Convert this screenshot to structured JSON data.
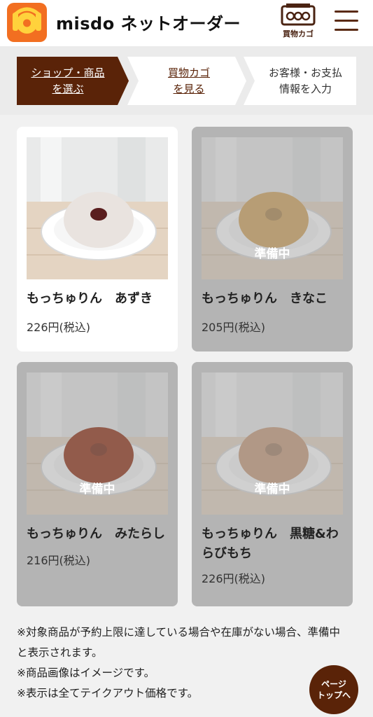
{
  "header": {
    "brand": "misdo ネットオーダー",
    "cart_label": "買物カゴ",
    "brand_color": "#f26f21",
    "accent_color": "#5a2308"
  },
  "steps": [
    {
      "line1": "ショップ・商品",
      "line2": "を選ぶ",
      "active": true
    },
    {
      "line1": "買物カゴ",
      "line2": "を見る",
      "active": false
    },
    {
      "line1": "お客様・お支払",
      "line2": "情報を入力",
      "active": false
    }
  ],
  "products": [
    {
      "name": "もっちゅりん　あずき",
      "price": "226円(税込)",
      "status": "",
      "donut_color": "#e9e3df",
      "icon": "azuki-donut-photo"
    },
    {
      "name": "もっちゅりん　きなこ",
      "price": "205円(税込)",
      "status": "準備中",
      "donut_color": "#d2a25a",
      "icon": "kinako-donut-photo"
    },
    {
      "name": "もっちゅりん　みたらし",
      "price": "216円(税込)",
      "status": "準備中",
      "donut_color": "#8e2a0e",
      "icon": "mitarashi-donut-photo"
    },
    {
      "name": "もっちゅりん　黒糖&わらびもち",
      "price": "226円(税込)",
      "status": "準備中",
      "donut_color": "#c79a79",
      "icon": "kokuto-donut-photo"
    }
  ],
  "notes": [
    "※対象商品が予約上限に達している場合や在庫がない場合、準備中と表示されます。",
    "※商品画像はイメージです。",
    "※表示は全てテイクアウト価格です。"
  ],
  "page_top": {
    "line1": "ページ",
    "line2": "トップへ"
  }
}
